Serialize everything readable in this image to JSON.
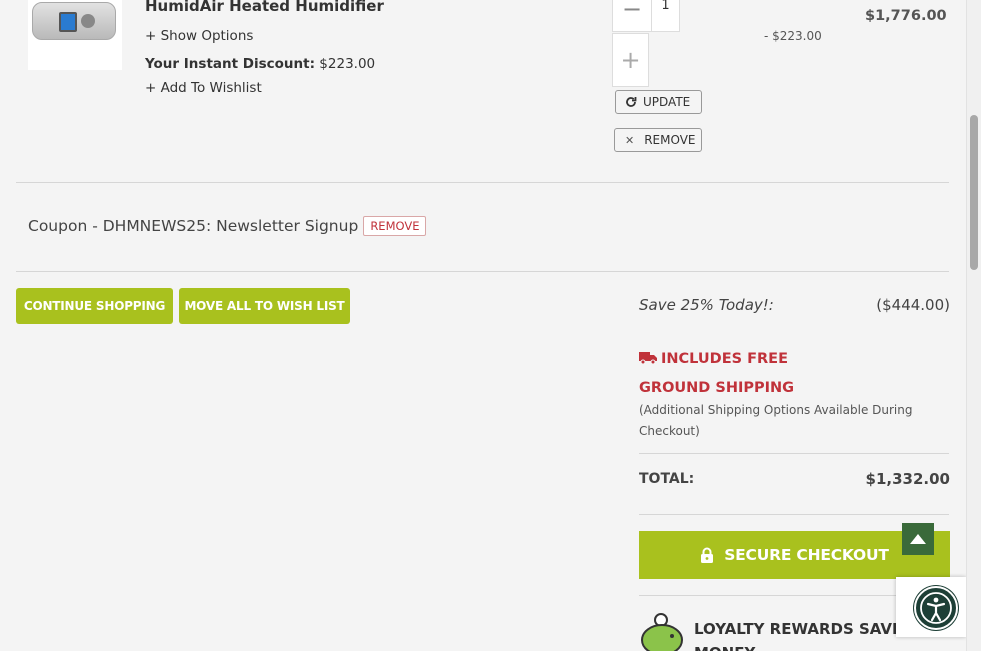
{
  "product": {
    "title": "HumidAir Heated Humidifier",
    "show_options": "+ Show Options",
    "discount_label": "Your Instant Discount:",
    "discount_value": "$223.00",
    "add_wishlist": "+ Add To Wishlist",
    "quantity": "1",
    "minus": "−",
    "plus": "+",
    "update_label": "UPDATE",
    "remove_label": "REMOVE",
    "line_discount": "- $223.00",
    "line_price": "$1,776.00"
  },
  "coupon": {
    "text": "Coupon - DHMNEWS25: Newsletter Signup",
    "remove_label": "REMOVE"
  },
  "actions": {
    "continue_shopping": "CONTINUE SHOPPING",
    "move_all_wishlist": "MOVE ALL TO WISH LIST"
  },
  "summary": {
    "save_label": "Save 25% Today!:",
    "save_value": "($444.00)",
    "shipping_headline": "INCLUDES FREE GROUND SHIPPING",
    "shipping_note": "(Additional Shipping Options Available During Checkout)",
    "total_label": "TOTAL:",
    "total_value": "$1,332.00",
    "checkout_label": "SECURE CHECKOUT",
    "loyalty_text": "LOYALTY REWARDS SAVE MONEY"
  },
  "colors": {
    "accent_green": "#a9c11e",
    "alert_red": "#c0323a",
    "back_to_top": "#3a6a3a",
    "accessibility": "#1d3f36"
  },
  "icons": [
    "refresh-icon",
    "close-icon",
    "truck-icon",
    "lock-icon",
    "piggy-bank-icon",
    "arrow-up-icon",
    "accessibility-icon"
  ]
}
